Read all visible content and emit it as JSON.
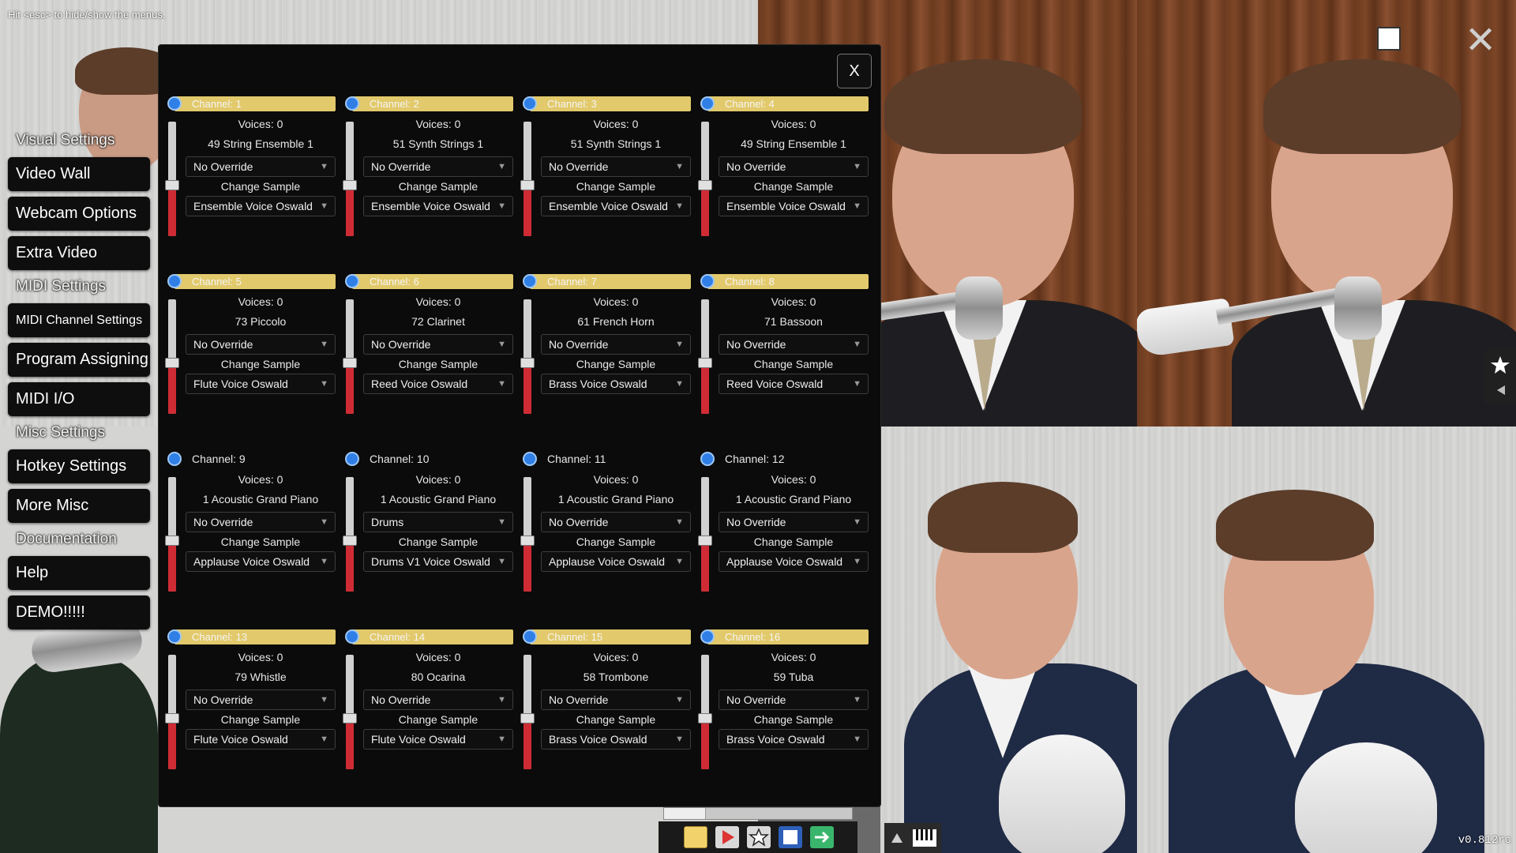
{
  "hint": "Hit <esc> to hide/show the menus.",
  "version": "v0.812rc",
  "menu": {
    "categories": [
      "Visual Settings",
      "MIDI Settings",
      "Misc Settings",
      "Documentation"
    ],
    "buttons": [
      "Video Wall",
      "Webcam Options",
      "Extra Video",
      "MIDI Channel Settings",
      "Program Assigning",
      "MIDI I/O",
      "Hotkey Settings",
      "More Misc",
      "Help",
      "DEMO!!!!!"
    ]
  },
  "dialog": {
    "close_label": "X",
    "voices_prefix": "Voices: ",
    "change_sample_label": "Change Sample",
    "channels": [
      {
        "label": "Channel: 1",
        "voices": "Voices: 0",
        "instrument": "49 String Ensemble 1",
        "override": "No Override",
        "sample": "Ensemble Voice Oswald",
        "highlight": true,
        "level": 0.45
      },
      {
        "label": "Channel: 2",
        "voices": "Voices: 0",
        "instrument": "51 Synth Strings 1",
        "override": "No Override",
        "sample": "Ensemble Voice Oswald",
        "highlight": true,
        "level": 0.45
      },
      {
        "label": "Channel: 3",
        "voices": "Voices: 0",
        "instrument": "51 Synth Strings 1",
        "override": "No Override",
        "sample": "Ensemble Voice Oswald",
        "highlight": true,
        "level": 0.45
      },
      {
        "label": "Channel: 4",
        "voices": "Voices: 0",
        "instrument": "49 String Ensemble 1",
        "override": "No Override",
        "sample": "Ensemble Voice Oswald",
        "highlight": true,
        "level": 0.45
      },
      {
        "label": "Channel: 5",
        "voices": "Voices: 0",
        "instrument": "73 Piccolo",
        "override": "No Override",
        "sample": "Flute Voice Oswald",
        "highlight": true,
        "level": 0.45
      },
      {
        "label": "Channel: 6",
        "voices": "Voices: 0",
        "instrument": "72 Clarinet",
        "override": "No Override",
        "sample": "Reed Voice Oswald",
        "highlight": true,
        "level": 0.45
      },
      {
        "label": "Channel: 7",
        "voices": "Voices: 0",
        "instrument": "61 French Horn",
        "override": "No Override",
        "sample": "Brass Voice Oswald",
        "highlight": true,
        "level": 0.45
      },
      {
        "label": "Channel: 8",
        "voices": "Voices: 0",
        "instrument": "71 Bassoon",
        "override": "No Override",
        "sample": "Reed Voice Oswald",
        "highlight": true,
        "level": 0.45
      },
      {
        "label": "Channel: 9",
        "voices": "Voices: 0",
        "instrument": "1 Acoustic Grand Piano",
        "override": "No Override",
        "sample": "Applause Voice Oswald",
        "highlight": false,
        "level": 0.45
      },
      {
        "label": "Channel: 10",
        "voices": "Voices: 0",
        "instrument": "1 Acoustic Grand Piano",
        "override": "Drums",
        "sample": "Drums V1 Voice Oswald",
        "highlight": false,
        "level": 0.45
      },
      {
        "label": "Channel: 11",
        "voices": "Voices: 0",
        "instrument": "1 Acoustic Grand Piano",
        "override": "No Override",
        "sample": "Applause Voice Oswald",
        "highlight": false,
        "level": 0.45
      },
      {
        "label": "Channel: 12",
        "voices": "Voices: 0",
        "instrument": "1 Acoustic Grand Piano",
        "override": "No Override",
        "sample": "Applause Voice Oswald",
        "highlight": false,
        "level": 0.45
      },
      {
        "label": "Channel: 13",
        "voices": "Voices: 0",
        "instrument": "79 Whistle",
        "override": "No Override",
        "sample": "Flute Voice Oswald",
        "highlight": true,
        "level": 0.45
      },
      {
        "label": "Channel: 14",
        "voices": "Voices: 0",
        "instrument": "80 Ocarina",
        "override": "No Override",
        "sample": "Flute Voice Oswald",
        "highlight": true,
        "level": 0.45
      },
      {
        "label": "Channel: 15",
        "voices": "Voices: 0",
        "instrument": "58 Trombone",
        "override": "No Override",
        "sample": "Brass Voice Oswald",
        "highlight": true,
        "level": 0.45
      },
      {
        "label": "Channel: 16",
        "voices": "Voices: 0",
        "instrument": "59 Tuba",
        "override": "No Override",
        "sample": "Brass Voice Oswald",
        "highlight": true,
        "level": 0.45
      }
    ]
  },
  "toolbar": {
    "progress": 0.22,
    "tools": [
      "folder-icon",
      "play-icon",
      "star-icon",
      "stop-icon",
      "export-icon"
    ]
  },
  "colors": {
    "highlight": "#e2c96b",
    "slider_fill": "#cf2b35",
    "dot": "#2f7fe6"
  }
}
